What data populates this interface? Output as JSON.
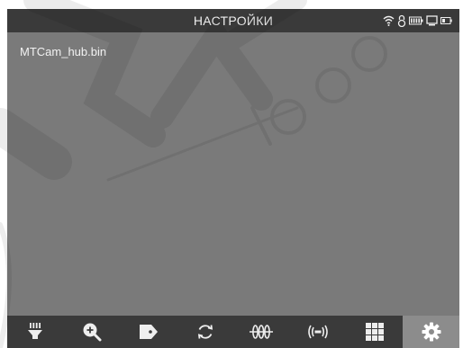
{
  "header": {
    "title": "НАСТРОЙКИ"
  },
  "status_icons": [
    "wifi-icon",
    "lock-icon",
    "battery-icon",
    "monitor-icon",
    "battery-small-icon"
  ],
  "files": [
    {
      "name": "MTCam_hub.bin"
    }
  ],
  "toolbar": {
    "items": [
      {
        "icon": "flashlight-icon",
        "active": false
      },
      {
        "icon": "zoom-in-icon",
        "active": false
      },
      {
        "icon": "tag-icon",
        "active": false
      },
      {
        "icon": "refresh-icon",
        "active": false
      },
      {
        "icon": "waveform-icon",
        "active": false
      },
      {
        "icon": "signal-icon",
        "active": false
      },
      {
        "icon": "grid-icon",
        "active": false
      },
      {
        "icon": "settings-gear-icon",
        "active": true
      }
    ]
  },
  "colors": {
    "bar_bg": "#3a3a3a",
    "screen_bg": "#7a7a7a",
    "active_tab_bg": "#8c8c8c",
    "text": "#eeeeee"
  }
}
